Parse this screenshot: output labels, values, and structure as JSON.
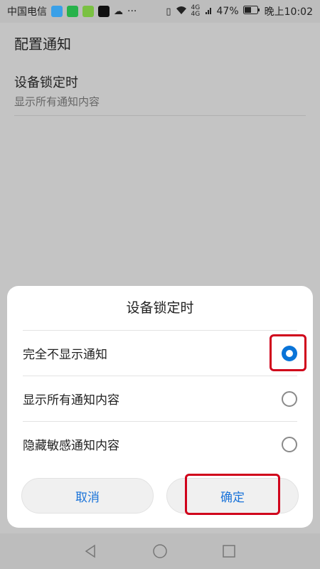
{
  "status_bar": {
    "carrier": "中国电信",
    "more": "···",
    "network": "4G 4G",
    "battery": "47%",
    "time": "晚上10:02"
  },
  "app_bar": {
    "title": "配置通知"
  },
  "setting": {
    "title": "设备锁定时",
    "subtitle": "显示所有通知内容"
  },
  "dialog": {
    "title": "设备锁定时",
    "options": [
      {
        "label": "完全不显示通知",
        "selected": true
      },
      {
        "label": "显示所有通知内容",
        "selected": false
      },
      {
        "label": "隐藏敏感通知内容",
        "selected": false
      }
    ],
    "cancel_label": "取消",
    "confirm_label": "确定"
  },
  "colors": {
    "accent": "#0a74d8",
    "highlight": "#d0021b",
    "overlay": "#c4c4c4"
  },
  "icons": [
    "sim-icon",
    "wifi-icon",
    "signal-icon",
    "battery-icon",
    "back-icon",
    "home-icon",
    "recents-icon"
  ]
}
